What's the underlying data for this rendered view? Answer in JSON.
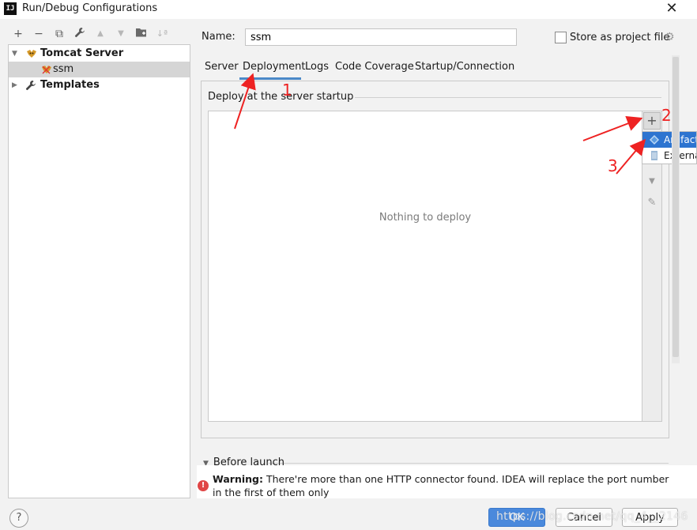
{
  "window": {
    "title": "Run/Debug Configurations",
    "app_icon_text": "IJ",
    "close_glyph": "✕"
  },
  "toolbar": {
    "add": "+",
    "remove": "−",
    "copy": "⧉",
    "edit_defaults": "🔧",
    "move_up": "▲",
    "move_down": "▼",
    "new_folder": "📁",
    "sort": "↓ª"
  },
  "tree": {
    "items": [
      {
        "label": "Tomcat Server",
        "bold": true,
        "expanded": true,
        "icon": "tomcat-icon"
      },
      {
        "label": "ssm",
        "bold": false,
        "selected": true,
        "icon": "tomcat-error-icon"
      },
      {
        "label": "Templates",
        "bold": true,
        "expanded": false,
        "icon": "wrench-icon"
      }
    ]
  },
  "form": {
    "name_label": "Name:",
    "name_value": "ssm",
    "store_label": "Store as project file",
    "store_checked": false
  },
  "tabs": [
    "Server",
    "Deployment",
    "Logs",
    "Code Coverage",
    "Startup/Connection"
  ],
  "active_tab": "Deployment",
  "deployment": {
    "section_title": "Deploy at the server startup",
    "empty_text": "Nothing to deploy",
    "add_glyph": "+",
    "popup_items": [
      "Artifact...",
      "External Source..."
    ]
  },
  "before_launch": {
    "label": "Before launch"
  },
  "warning": {
    "bold": "Warning:",
    "text": "There're more than one HTTP connector found. IDEA will replace the port number in the first of them only"
  },
  "buttons": {
    "help": "?",
    "ok": "OK",
    "cancel": "Cancel",
    "apply": "Apply"
  },
  "annotations": [
    "1",
    "2",
    "3"
  ],
  "watermark": "https://blog.csdn.net/qq_4__2146",
  "colors": {
    "accent": "#4a88c7",
    "selection": "#2d74d0",
    "annotation": "#ee2222",
    "warning": "#e04646"
  }
}
